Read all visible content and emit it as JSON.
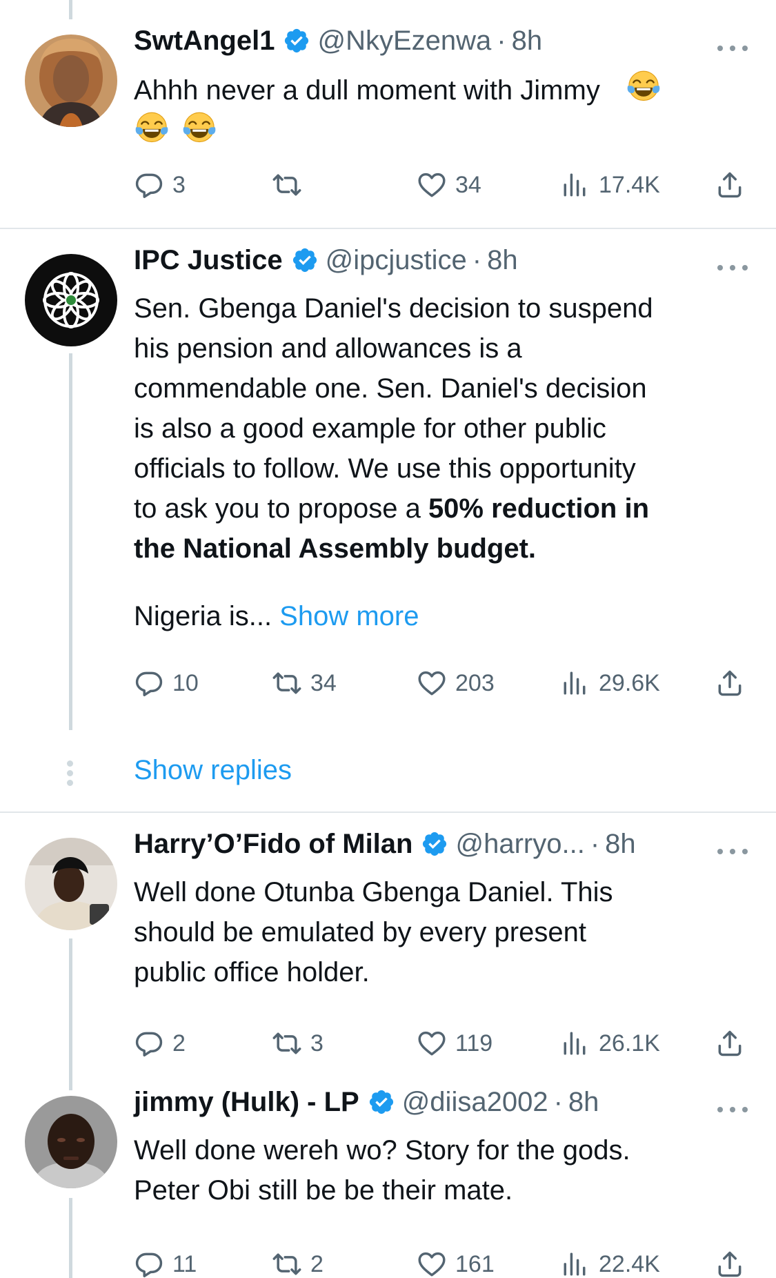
{
  "tweets": [
    {
      "name": "SwtAngel1",
      "handle": "@NkyEzenwa",
      "sep": "·",
      "time": "8h",
      "text": "Ahhh never a dull moment with Jimmy",
      "emoji": "face-with-tears-of-joy",
      "replies": "3",
      "reposts": "",
      "likes": "34",
      "views": "17.4K"
    },
    {
      "name": "IPC Justice",
      "handle": "@ipcjustice",
      "sep": "·",
      "time": "8h",
      "lines": [
        "Sen. Gbenga Daniel's decision to suspend",
        "his pension and allowances is a",
        "commendable one. Sen. Daniel's decision",
        "is also a good example for other public",
        "officials to follow. We use this opportunity"
      ],
      "line6_plain": "to ask you to propose a ",
      "line6_bold": "50% reduction in",
      "line7_bold": "the National Assembly budget.",
      "line8": "Nigeria is... ",
      "show_more": "Show more",
      "replies": "10",
      "reposts": "34",
      "likes": "203",
      "views": "29.6K"
    },
    {
      "name": "Harry’O’Fido of Milan",
      "handle": "@harryo...",
      "sep": "·",
      "time": "8h",
      "lines": [
        "Well done Otunba Gbenga Daniel. This",
        "should be emulated by every present",
        "public office holder."
      ],
      "replies": "2",
      "reposts": "3",
      "likes": "119",
      "views": "26.1K"
    },
    {
      "name": "jimmy (Hulk) - LP",
      "handle": "@diisa2002",
      "sep": "·",
      "time": "8h",
      "lines": [
        "Well done wereh wo? Story for the gods.",
        "Peter Obi still be be their mate."
      ],
      "replies": "11",
      "reposts": "2",
      "likes": "161",
      "views": "22.4K"
    }
  ],
  "show_replies": "Show replies",
  "colors": {
    "text": "#0f1419",
    "secondary": "#536471",
    "link": "#1d9bf0",
    "verified": "#1d9bf0",
    "divider": "#e1e6ea",
    "thread_line": "#cfd9de"
  },
  "icons": [
    "verified-badge-icon",
    "reply-icon",
    "repost-icon",
    "like-icon",
    "views-icon",
    "share-icon",
    "more-icon",
    "face-with-tears-of-joy-emoji"
  ]
}
